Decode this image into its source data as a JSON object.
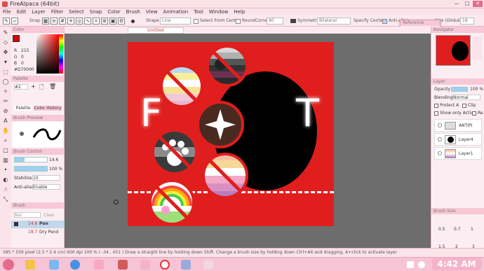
{
  "app": {
    "title": "FireAlpaca (64bit)",
    "window_controls": [
      "—",
      "□",
      "✕"
    ]
  },
  "menu": [
    "File",
    "Edit",
    "Layer",
    "Filter",
    "Select",
    "Snap",
    "Color",
    "Brush",
    "View",
    "Animation",
    "Tool",
    "Window",
    "Help"
  ],
  "toolbar": {
    "snap_label": "Snap",
    "shape_label": "Shape",
    "shape_value": "Line",
    "select_from_center": "Select From Center",
    "round_corner": "RoundCorner",
    "round_value": "80",
    "symmetry_label": "Symmetry",
    "symmetry_value": "Bilateral",
    "specify_center": "Specify Center",
    "antialias": "Anti-alias",
    "zoom_label": "Size (Global)",
    "zoom_value": "18"
  },
  "document_tab": "Untitled",
  "reference_window": {
    "title": "Reference"
  },
  "left_panel": {
    "color_header": "Color",
    "rgb": [
      {
        "label": "R",
        "value": "215"
      },
      {
        "label": "G",
        "value": "0"
      },
      {
        "label": "B",
        "value": "0"
      }
    ],
    "hex": "#D70000",
    "palette_header": "Palette",
    "palette_value": "#2",
    "palette_tabs": [
      "Palette",
      "Color History"
    ],
    "brush_preview_header": "Brush Preview",
    "brush_control_header": "Brush Control",
    "size_value": "14.6",
    "opacity_value": "100 %",
    "stabilize_label": "Stabilize",
    "stabilize_value": "10",
    "antialias_label": "Anti-alias",
    "antialias_value": "Enable",
    "brush_header": "Brush",
    "brush_search": "Nar",
    "brush_clear": "Clear",
    "brushes": [
      {
        "size": "14.6",
        "name": "Pen"
      },
      {
        "size": "18.7",
        "name": "Dry Pend"
      }
    ]
  },
  "right_panel": {
    "navigator_header": "Navigator",
    "layer_header": "Layer",
    "opacity_label": "Opacity",
    "opacity_value": "100 %",
    "blending_label": "Blending",
    "blending_value": "Normal",
    "protect_alpha": "Protect A",
    "clip": "Clip",
    "show_only_active": "Show only Activ",
    "ref": "Re",
    "layers": [
      {
        "name": "ANTIPI"
      },
      {
        "name": "Layer4"
      },
      {
        "name": "Layer1"
      }
    ],
    "brush_size_header": "Brush Size",
    "brush_sizes": [
      "0.5",
      "0.7",
      "1",
      "1.5",
      "2",
      "3"
    ]
  },
  "canvas": {
    "letters": [
      "F",
      "T"
    ]
  },
  "status": "585 * 559 pixel  (2.5 * 2.4 cm)  600 dpi  100 %  ( -34 , 451 )  Draw a straight line by holding down Shift. Change a brush size by holding down Ctrl+Alt and dragging. A+click to activate layer",
  "taskbar": {
    "time": "4:42 AM"
  },
  "colors": {
    "canvas": "#e01e1e",
    "primary": "#d70000",
    "accent_pink": "#f6c4d4"
  }
}
